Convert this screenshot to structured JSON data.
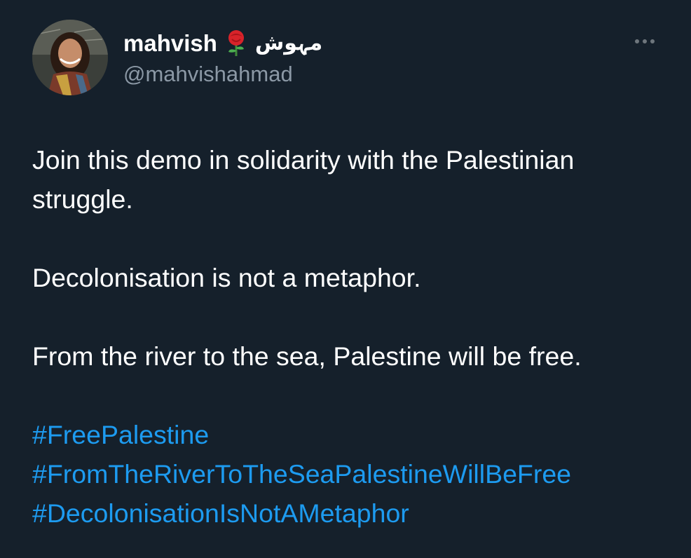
{
  "author": {
    "display_name": "mahvish",
    "emoji_icon": "rose-icon",
    "urdu_name": "مہوش",
    "handle": "@mahvishahmad"
  },
  "menu": {
    "icon": "more-horizontal-icon"
  },
  "tweet": {
    "paragraphs": [
      "Join this demo in solidarity with the Palestinian struggle.",
      "Decolonisation is not a metaphor.",
      "From the river to the sea, Palestine will be free."
    ],
    "hashtags": [
      "#FreePalestine",
      "#FromTheRiverToTheSeaPalestineWillBeFree",
      "#DecolonisationIsNotAMetaphor"
    ]
  },
  "colors": {
    "background": "#15202b",
    "text": "#ffffff",
    "secondary_text": "#8b98a5",
    "link": "#1d9bf0"
  }
}
